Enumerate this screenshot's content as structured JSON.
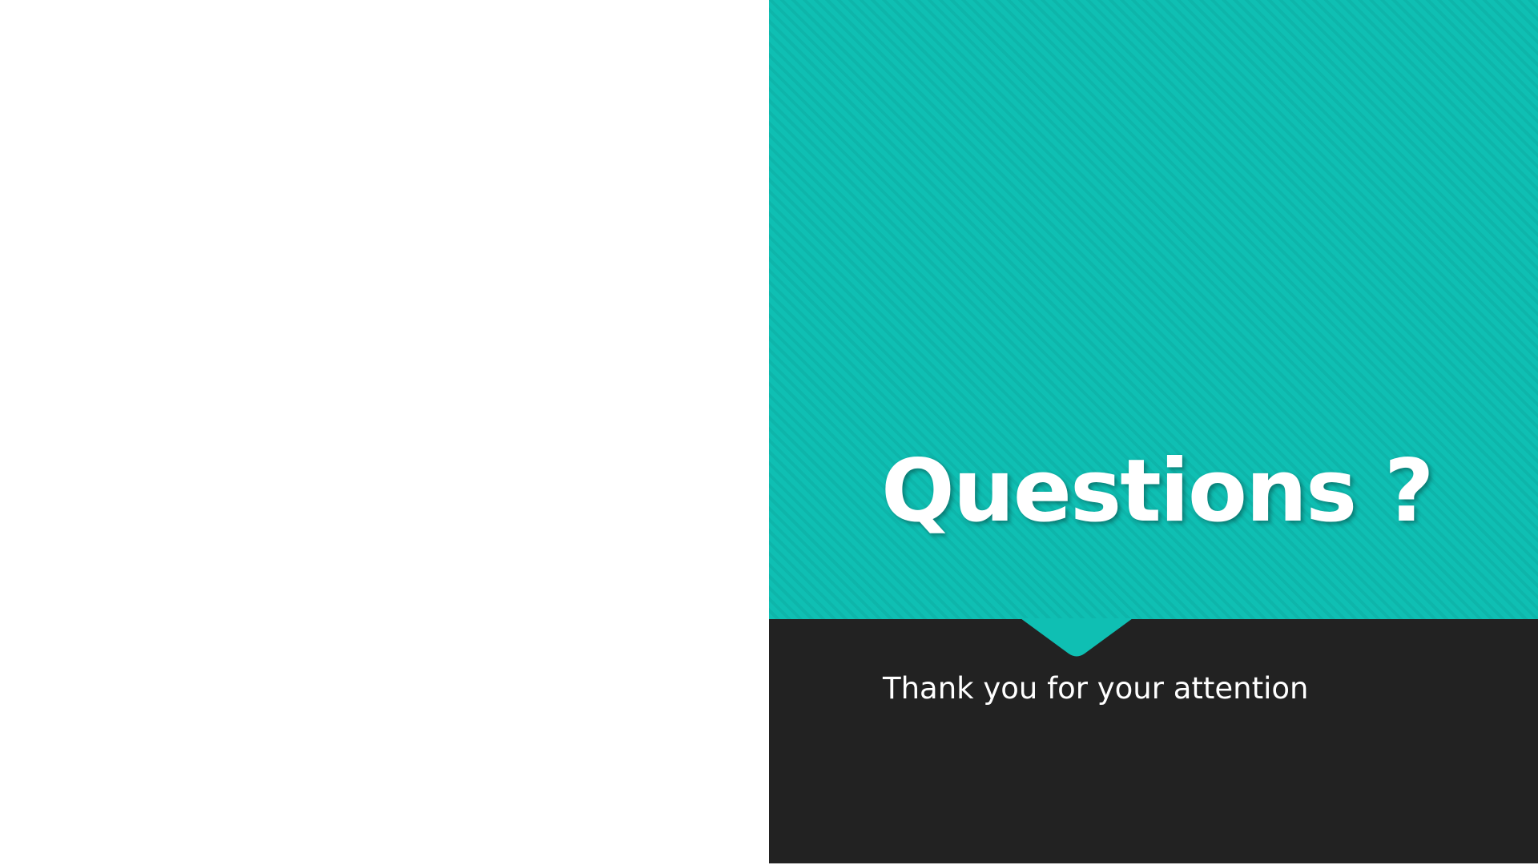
{
  "slide": {
    "title": "Questions ?",
    "subtitle": "Thank you for your attention"
  },
  "colors": {
    "accent": "#0fbfb3",
    "dark": "#222222",
    "text": "#ffffff",
    "background": "#ffffff"
  }
}
